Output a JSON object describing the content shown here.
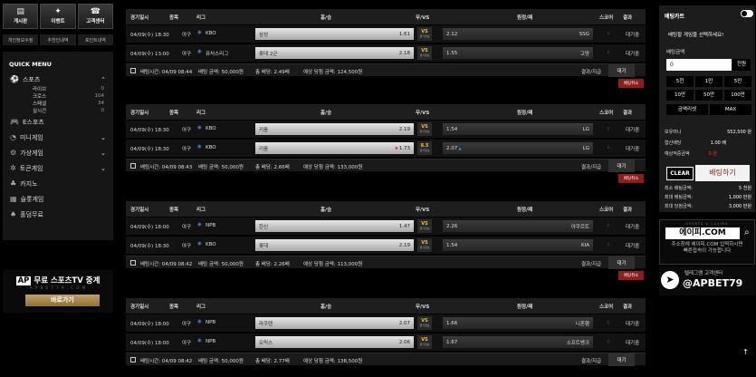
{
  "left": {
    "top_icons": [
      {
        "icon": "board-icon",
        "label": "게시판"
      },
      {
        "icon": "event-icon",
        "label": "이벤트"
      },
      {
        "icon": "support-icon",
        "label": "고객센터"
      }
    ],
    "sub_links": [
      "개인정보수정",
      "추천인내역",
      "포인트내역"
    ],
    "quick_menu_title": "QUICK MENU",
    "categories": [
      {
        "icon": "sports-icon",
        "label": "스포츠",
        "sub": [
          {
            "label": "라이브",
            "count": "0"
          },
          {
            "label": "크로스",
            "count": "104"
          },
          {
            "label": "스페셜",
            "count": "34"
          },
          {
            "label": "실시간",
            "count": "0"
          }
        ]
      },
      {
        "icon": "esports-icon",
        "label": "E스포츠"
      },
      {
        "icon": "minigame-icon",
        "label": "미니게임"
      },
      {
        "icon": "virtual-icon",
        "label": "가상게임"
      },
      {
        "icon": "token-icon",
        "label": "토큰게임"
      },
      {
        "icon": "casino-icon",
        "label": "카지노"
      },
      {
        "icon": "slot-icon",
        "label": "슬롯게임"
      },
      {
        "icon": "holdem-icon",
        "label": "홀덤무료"
      }
    ],
    "banner": {
      "logo": "AP",
      "title": "무료 스포츠TV 중계",
      "sub": "A P B E T 7 9 . C O M",
      "button": "바로가기"
    }
  },
  "columns": [
    "경기일시",
    "종목",
    "리그",
    "홈/승",
    "무/VS",
    "원정/패",
    "스코어",
    "결과"
  ],
  "vs_label": "VS",
  "vs_sub": "경기정보",
  "score_sep": ":",
  "groups": [
    {
      "rows": [
        {
          "date": "04/09(수) 18:30",
          "sport": "야구",
          "league": "KBO",
          "home": "삼성",
          "home_odds": "1.61",
          "draw": "",
          "away": "SSG",
          "away_odds": "2.12",
          "result": "대기중"
        },
        {
          "date": "04/09(수) 13:00",
          "sport": "야구",
          "league": "퓨처스리그",
          "home": "롯데 2군",
          "home_odds": "2.18",
          "draw": "",
          "away": "고양",
          "away_odds": "1.55",
          "result": "대기중"
        }
      ],
      "summary": {
        "time": "배팅시간: 04/09 08:44",
        "bet": "배팅 금액: 50,000원",
        "total": "총 배당: 2.49배",
        "win": "예상 당첨 금액: 124,500원",
        "ratio": "결과/지급",
        "status": "대기"
      },
      "cancel": "배팅취소"
    },
    {
      "rows": [
        {
          "date": "04/09(수) 18:30",
          "sport": "야구",
          "league": "KBO",
          "home": "키움",
          "home_odds": "2.19",
          "draw": "",
          "away": "LG",
          "away_odds": "1.54",
          "result": "대기중"
        },
        {
          "date": "04/09(수) 18:30",
          "sport": "야구",
          "league": "KBO",
          "home": "키움",
          "home_odds": "1.73",
          "draw": "8.5",
          "away": "LG",
          "away_odds": "2.07",
          "result": "대기중"
        }
      ],
      "summary": {
        "time": "배팅시간: 04/09 08:43",
        "bet": "배팅 금액: 50,000원",
        "total": "총 배당: 2.66배",
        "win": "예상 당첨 금액: 133,000원",
        "ratio": "결과/지급",
        "status": "대기"
      },
      "cancel": "배팅취소"
    },
    {
      "rows": [
        {
          "date": "04/09(수) 18:00",
          "sport": "야구",
          "league": "NPB",
          "home": "한신",
          "home_odds": "1.47",
          "draw": "",
          "away": "야쿠르트",
          "away_odds": "2.26",
          "result": "대기중"
        },
        {
          "date": "04/09(수) 18:30",
          "sport": "야구",
          "league": "KBO",
          "home": "롯데",
          "home_odds": "2.19",
          "draw": "",
          "away": "KIA",
          "away_odds": "1.54",
          "result": "대기중"
        }
      ],
      "summary": {
        "time": "배팅시간: 04/09 08:42",
        "bet": "배팅 금액: 50,000원",
        "total": "총 배당: 2.26배",
        "win": "예상 당첨 금액: 113,000원",
        "ratio": "결과/지급",
        "status": "대기"
      },
      "cancel": "배팅취소"
    },
    {
      "rows": [
        {
          "date": "04/09(수) 18:00",
          "sport": "야구",
          "league": "NPB",
          "home": "라쿠텐",
          "home_odds": "2.07",
          "draw": "",
          "away": "니혼햄",
          "away_odds": "1.66",
          "result": "대기중"
        },
        {
          "date": "04/09(수) 18:00",
          "sport": "야구",
          "league": "NPB",
          "home": "오릭스",
          "home_odds": "2.06",
          "draw": "",
          "away": "소프트뱅크",
          "away_odds": "1.67",
          "result": "대기중"
        }
      ],
      "summary": {
        "time": "배팅시간: 04/09 08:42",
        "bet": "배팅 금액: 50,000원",
        "total": "총 배당: 2.77배",
        "win": "예상 당첨 금액: 138,500원",
        "ratio": "결과/지급",
        "status": "대기"
      }
    }
  ],
  "slip": {
    "title": "배팅카트",
    "message": "배팅할 게임을 선택하세요!",
    "amount_label": "배팅금액",
    "amount_value": "0",
    "amount_unit": "전원",
    "quick_buttons": [
      "5천",
      "1만",
      "5만",
      "10만",
      "50만",
      "100만"
    ],
    "reset_button": "금액리셋",
    "max_button": "MAX",
    "info": [
      {
        "label": "보유머니",
        "value": "552,500 원"
      },
      {
        "label": "합산배당",
        "value": "1.00 배"
      },
      {
        "label": "예상적중금액",
        "value": "0 원"
      }
    ],
    "clear_button": "CLEAR",
    "bet_button": "배팅하기",
    "limits": [
      {
        "label": "최소 배팅금액:",
        "value": "5 천원"
      },
      {
        "label": "최대 배팅금액:",
        "value": "1,000 만원"
      },
      {
        "label": "최대 당첨금액:",
        "value": "3,000 만원"
      }
    ]
  },
  "ad": {
    "sub": "SPORTS & CASINO",
    "domain": "에이피.COM",
    "text1": "주소창에 에이피.COM 입력하시면",
    "text2": "빠른접속이 가능합니다",
    "tg_text": "텔레그램 고객센터",
    "tg_handle": "@APBET79"
  }
}
